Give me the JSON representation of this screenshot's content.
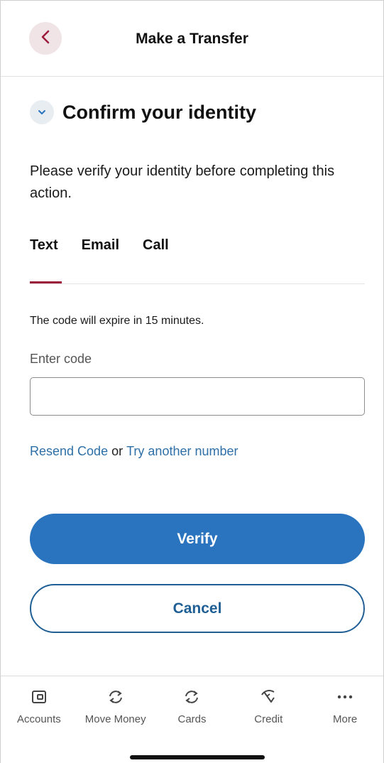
{
  "header": {
    "title": "Make a Transfer",
    "back_icon": "chevron-left-icon"
  },
  "section": {
    "title": "Confirm your identity",
    "collapse_icon": "chevron-down-icon",
    "instructions": "Please verify your identity before completing this action."
  },
  "tabs": [
    {
      "label": "Text",
      "active": true
    },
    {
      "label": "Email",
      "active": false
    },
    {
      "label": "Call",
      "active": false
    }
  ],
  "form": {
    "expire_note": "The code will expire in 15 minutes.",
    "code_label": "Enter code",
    "code_value": "",
    "resend_link": "Resend Code",
    "or_text": "or",
    "another_number_link": "Try another number"
  },
  "buttons": {
    "verify": "Verify",
    "cancel": "Cancel"
  },
  "nav": {
    "items": [
      {
        "label": "Accounts",
        "icon": "wallet-icon"
      },
      {
        "label": "Move Money",
        "icon": "transfer-icon"
      },
      {
        "label": "Cards",
        "icon": "transfer-icon"
      },
      {
        "label": "Credit",
        "icon": "gauge-icon"
      },
      {
        "label": "More",
        "icon": "more-dots-icon"
      }
    ]
  },
  "colors": {
    "accent_red": "#9b1c3a",
    "primary_blue": "#2a74bf",
    "link_blue": "#2d6fa6"
  }
}
